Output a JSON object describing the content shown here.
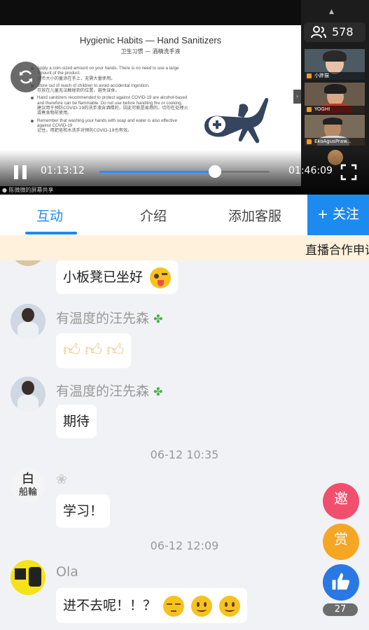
{
  "player": {
    "slide_title": "Hygienic Habits — Hand Sanitizers",
    "slide_subtitle": "卫生习惯 — 酒精洗手液",
    "bullets": [
      {
        "en": "Apply a coin-sized amount on your hands. There is no need to use a large amount of the product.",
        "zh": "硬币大小的量涂在手上，无需大量使用。"
      },
      {
        "en": "Store out of reach of children to avoid accidental ingestion.",
        "zh": "存放在儿童无法触碰到的位置，避免误食。"
      },
      {
        "en": "Hand sanitizers recommended to protect against COVID-19 are alcohol-based and therefore can be flammable. Do not use before handling fire or cooking.",
        "zh": "建议用于预防COVID-19的洗手液含酒精的，因此可能是易燃的。切勿在处理火或煮食物前使用。"
      },
      {
        "en": "Remember that washing your hands with soap and water is also effective against COVID-19",
        "zh": "记住，用肥皂和水洗手对预防COVID-19也有效。"
      }
    ],
    "viewer_count": "578",
    "participants": [
      {
        "name": "小胖猫"
      },
      {
        "name": "YOGHI"
      },
      {
        "name": "EkoAgusPraw..."
      }
    ],
    "current_time": "01:13:12",
    "total_time": "01:46:09",
    "progress": 0.68,
    "screen_share_text": "● 陈微微的屏幕共享"
  },
  "tabs": [
    {
      "label": "互动",
      "active": true
    },
    {
      "label": "介绍",
      "active": false
    },
    {
      "label": "添加客服",
      "active": false
    }
  ],
  "follow_label": "+ 关注",
  "banner_text": "直播合作申请",
  "chat": {
    "messages": [
      {
        "user": "",
        "text": "小板凳已坐好"
      },
      {
        "user": "有温度的汪先森",
        "text": ""
      },
      {
        "user": "有温度的汪先森",
        "text": "期待"
      },
      {
        "user": "❀",
        "text": "学习！",
        "timestamp": "06-12 10:35"
      },
      {
        "user": "Ola",
        "text": "进不去呢！！？",
        "timestamp": "06-12 12:09"
      }
    ],
    "avatar_text_bai": "白",
    "avatar_text_chuanlun": "船輪"
  },
  "floating": {
    "invite_label": "邀",
    "reward_label": "赏",
    "like_count": "27"
  },
  "colors": {
    "accent": "#1d8af0",
    "banner_bg": "#fff1dc",
    "invite": "#f0506e",
    "reward": "#f5a623"
  }
}
